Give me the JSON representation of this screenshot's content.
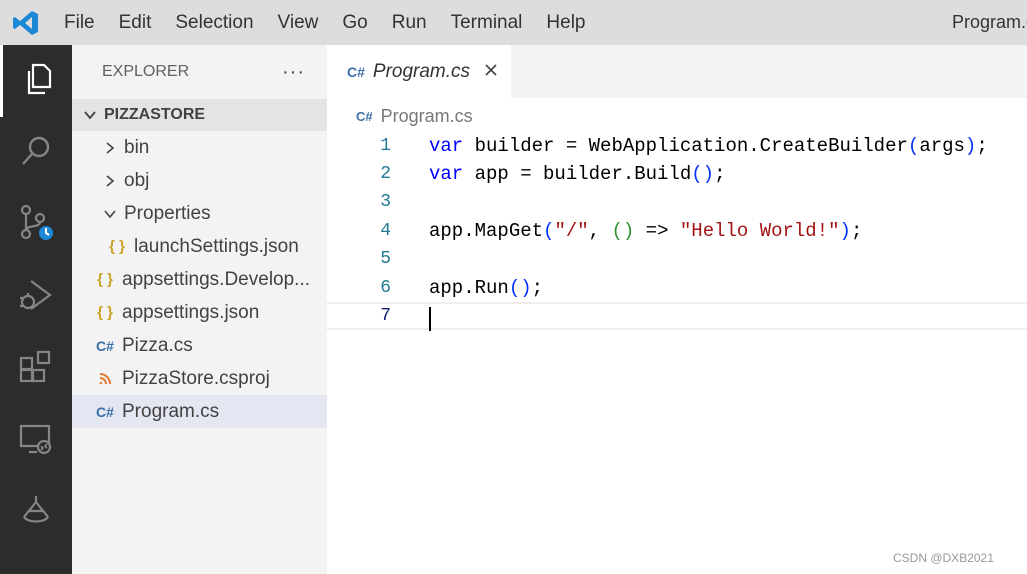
{
  "menu": {
    "items": [
      "File",
      "Edit",
      "Selection",
      "View",
      "Go",
      "Run",
      "Terminal",
      "Help"
    ],
    "window_title": "Program.cs"
  },
  "activity_bar": {
    "icons": [
      "files-icon",
      "search-icon",
      "source-control-icon",
      "run-debug-icon",
      "extensions-icon",
      "remote-explorer-icon",
      "tree-icon"
    ]
  },
  "sidebar": {
    "title": "EXPLORER",
    "more": "···",
    "folder": "PIZZASTORE",
    "items": [
      {
        "label": "bin",
        "kind": "folder"
      },
      {
        "label": "obj",
        "kind": "folder"
      },
      {
        "label": "Properties",
        "kind": "folder-open"
      },
      {
        "label": "launchSettings.json",
        "kind": "json"
      },
      {
        "label": "appsettings.Develop...",
        "kind": "json"
      },
      {
        "label": "appsettings.json",
        "kind": "json"
      },
      {
        "label": "Pizza.cs",
        "kind": "csharp"
      },
      {
        "label": "PizzaStore.csproj",
        "kind": "rss"
      },
      {
        "label": "Program.cs",
        "kind": "csharp"
      }
    ]
  },
  "editor": {
    "tab_label": "Program.cs",
    "breadcrumb": "Program.cs",
    "line_numbers": [
      "1",
      "2",
      "3",
      "4",
      "5",
      "6",
      "7"
    ],
    "tokens": {
      "l1": [
        "var",
        " builder = WebApplication.CreateBuilder",
        "(",
        "args",
        ")",
        ";"
      ],
      "l2": [
        "var",
        " app = builder.Build",
        "()",
        ";"
      ],
      "l4": [
        "app.MapGet",
        "(",
        "\"/\"",
        ", ",
        "()",
        " => ",
        "\"Hello World!\"",
        ")",
        ";"
      ],
      "l6": [
        "app.Run",
        "()",
        ";"
      ]
    }
  },
  "icons": {
    "csharp": "C#",
    "json": "{ }",
    "rss": "rss-icon"
  },
  "colors": {
    "accent": "#2c2c2c",
    "keyword": "#0000ff",
    "string": "#a31515",
    "line_number": "#237893"
  },
  "watermark": "CSDN @DXB2021"
}
